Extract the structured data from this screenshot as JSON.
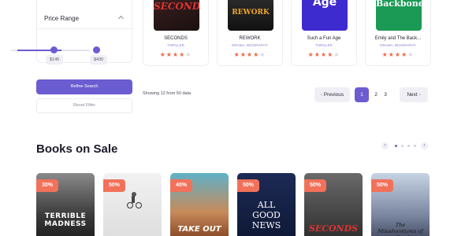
{
  "filters": {
    "price_range_title": "Price Range",
    "price_min": "$145",
    "price_max": "$430",
    "refine_label": "Refine Search",
    "reset_label": "Reset Filter"
  },
  "books": [
    {
      "title": "SECONDS",
      "category": "THRILLER",
      "cover_text": "SECONDS",
      "rating": 4
    },
    {
      "title": "REWORK",
      "category": "DRAMA, BIOGRAPHY",
      "cover_text": "REWORK",
      "rating": 4
    },
    {
      "title": "Such a Fun Age",
      "category": "THRILLER",
      "cover_text": "Age",
      "rating": 4
    },
    {
      "title": "Emily and The Back...",
      "category": "DRAMA, BIOGRAPHY",
      "cover_text": "Backbone",
      "rating": 4
    }
  ],
  "pagination": {
    "showing_text": "Showing 12 from 50 data",
    "previous_label": "Previous",
    "next_label": "Next",
    "pages": [
      "1",
      "2",
      "3"
    ],
    "active_page": "1"
  },
  "on_sale": {
    "title": "Books on Sale",
    "cards": [
      {
        "discount": "30%",
        "cover_text": "TERRIBLE MADNESS"
      },
      {
        "discount": "50%",
        "cover_text": ""
      },
      {
        "discount": "40%",
        "cover_text": "TAKE OUT"
      },
      {
        "discount": "50%",
        "cover_text": "ALL GOOD NEWS"
      },
      {
        "discount": "50%",
        "cover_text": "SECONDS"
      },
      {
        "discount": "50%",
        "cover_text": "The Misadventures of a Good"
      }
    ]
  },
  "colors": {
    "accent": "#6c5cd1",
    "badge": "#f2715a",
    "star": "#ef6a4a"
  }
}
